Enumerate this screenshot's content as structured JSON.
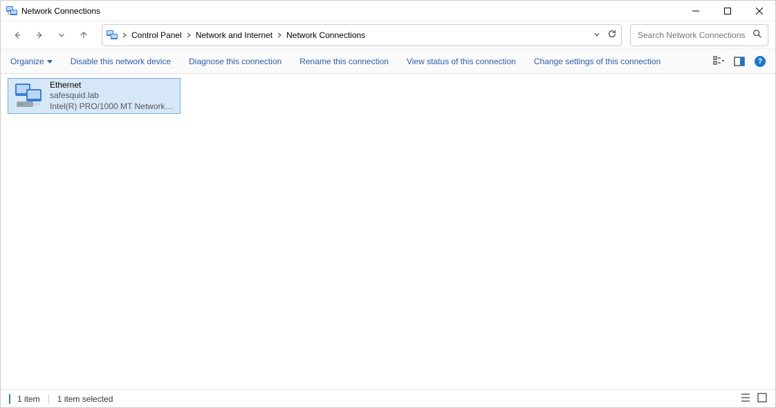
{
  "window": {
    "title": "Network Connections"
  },
  "breadcrumb": {
    "parts": [
      "Control Panel",
      "Network and Internet",
      "Network Connections"
    ]
  },
  "search": {
    "placeholder": "Search Network Connections"
  },
  "toolbar": {
    "organize": "Organize",
    "actions": [
      "Disable this network device",
      "Diagnose this connection",
      "Rename this connection",
      "View status of this connection",
      "Change settings of this connection"
    ]
  },
  "adapter": {
    "name": "Ethernet",
    "network": "safesquid.lab",
    "device": "Intel(R) PRO/1000 MT Network C..."
  },
  "status": {
    "count": "1 item",
    "selected": "1 item selected"
  },
  "help_glyph": "?"
}
